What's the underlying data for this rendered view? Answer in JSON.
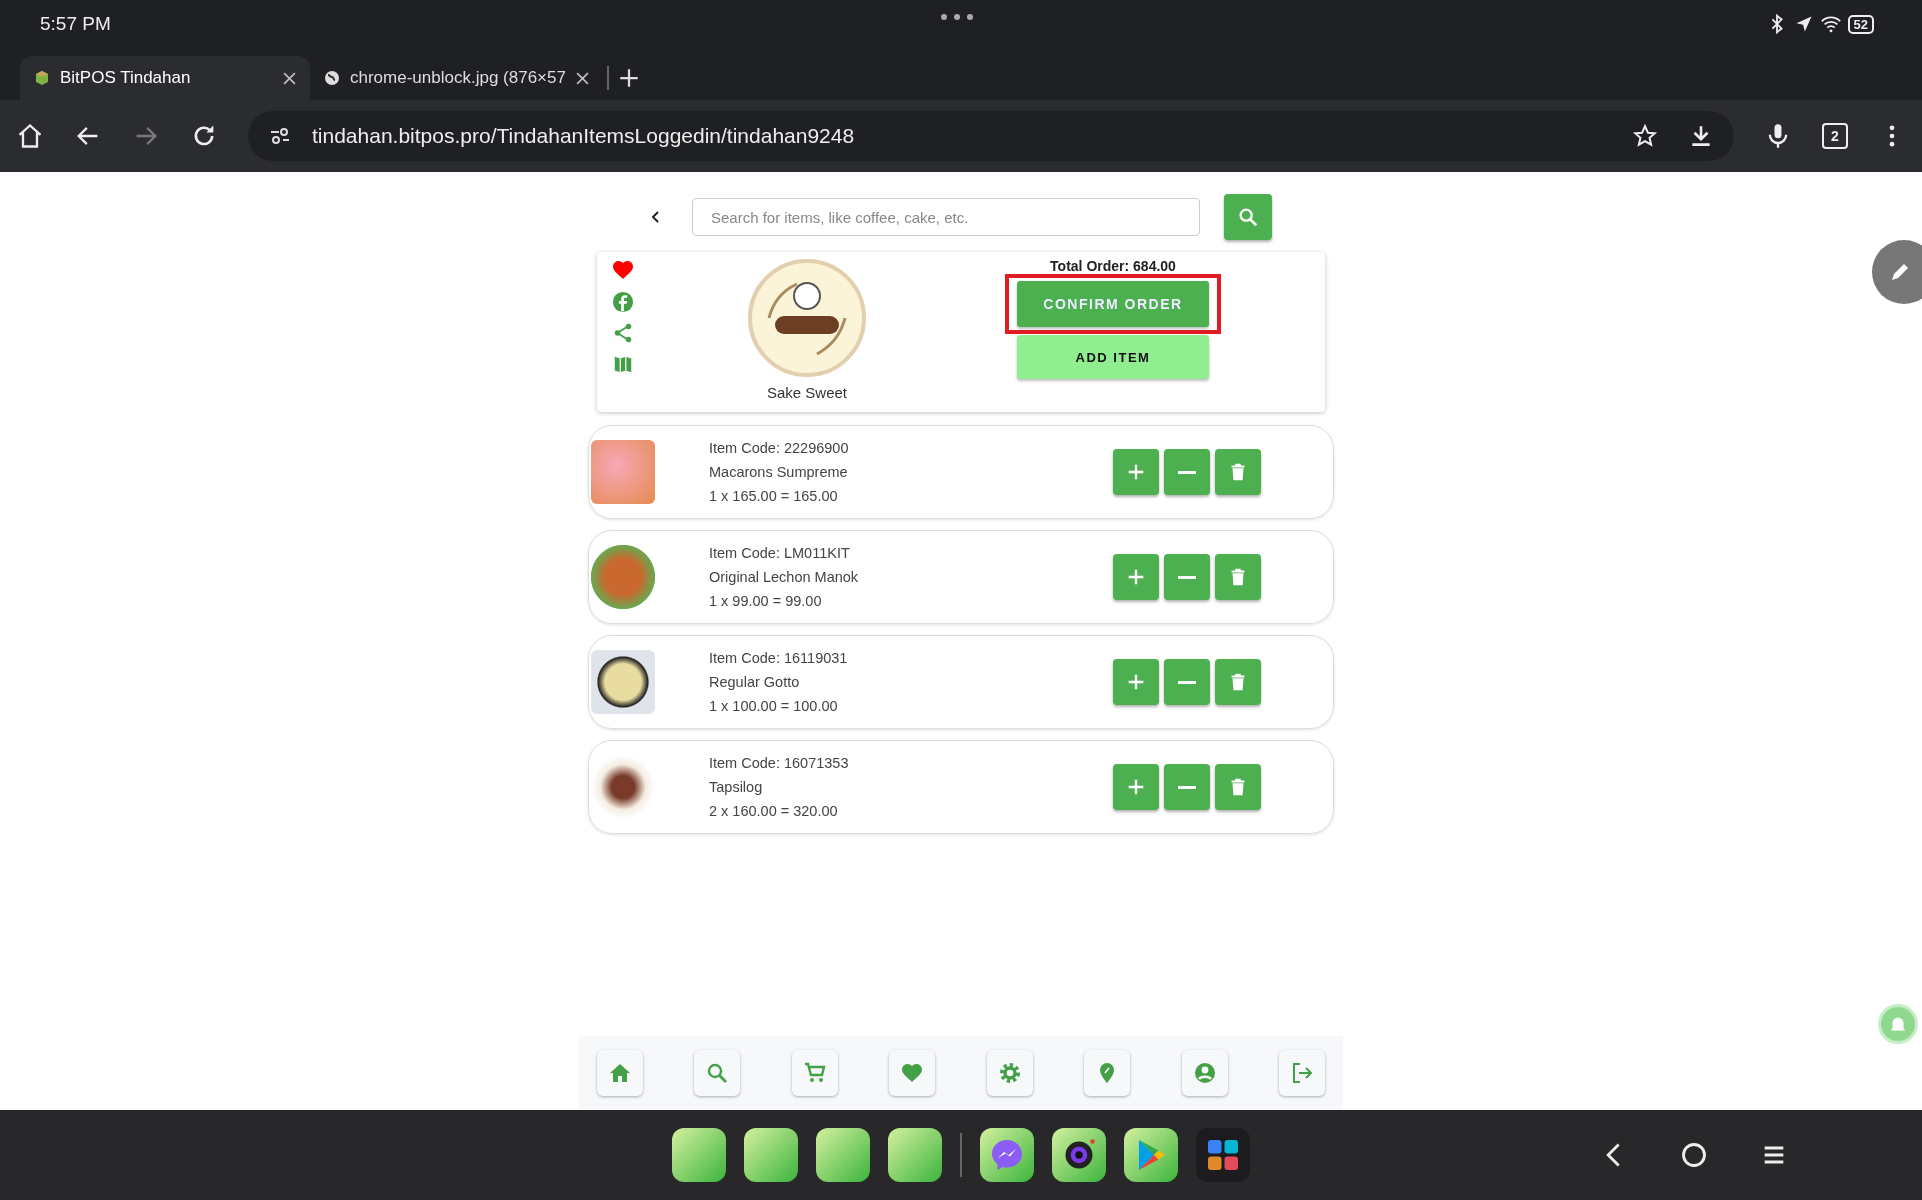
{
  "status_bar": {
    "time": "5:57 PM",
    "battery": "52"
  },
  "browser": {
    "tabs": [
      {
        "title": "BitPOS Tindahan",
        "selected": true
      },
      {
        "title": "chrome-unblock.jpg (876×57",
        "selected": false
      }
    ],
    "url": "tindahan.bitpos.pro/TindahanItemsLoggedin/tindahan9248",
    "tab_count": "2"
  },
  "search": {
    "placeholder": "Search for items, like coffee, cake, etc."
  },
  "store": {
    "name": "Sake Sweet",
    "total": "Total Order: 684.00",
    "actions": [
      {
        "label": "CONFIRM ORDER",
        "kind": "primary",
        "highlighted": true
      },
      {
        "label": "ADD ITEM",
        "kind": "secondary",
        "highlighted": false
      }
    ]
  },
  "items": [
    {
      "code": "Item Code: 22296900",
      "name": "Macarons Sumpreme",
      "line": "1 x 165.00 = 165.00"
    },
    {
      "code": "Item Code: LM011KIT",
      "name": "Original Lechon Manok",
      "line": "1 x 99.00 = 99.00"
    },
    {
      "code": "Item Code: 16119031",
      "name": "Regular Gotto",
      "line": "1 x 100.00 = 100.00"
    },
    {
      "code": "Item Code: 16071353",
      "name": "Tapsilog",
      "line": "2 x 160.00 = 320.00"
    }
  ]
}
